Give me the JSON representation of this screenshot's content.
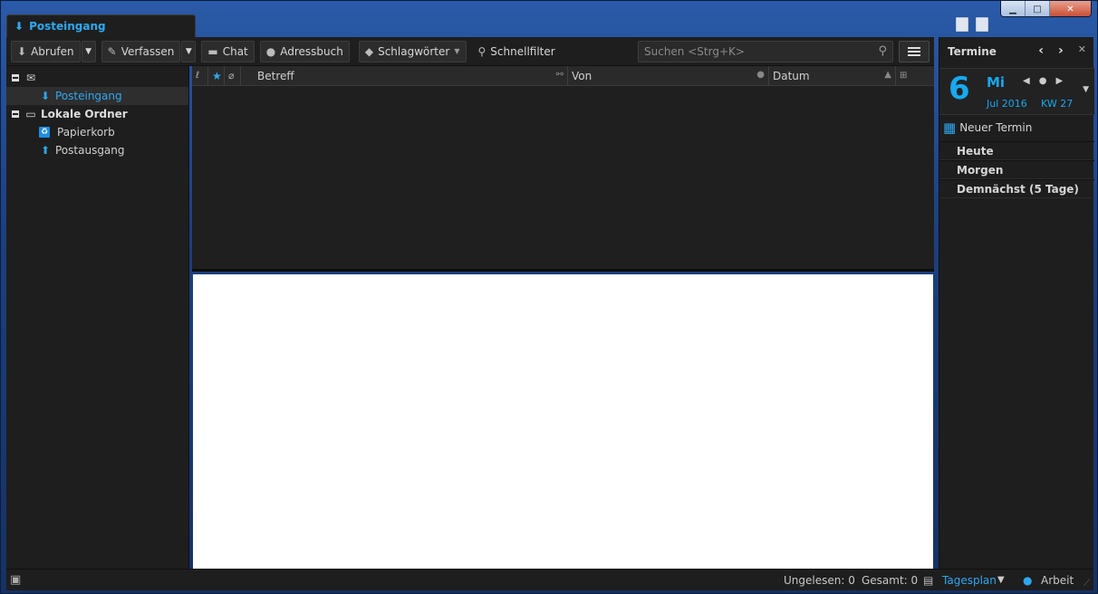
{
  "titlebar": {
    "tab_label": "Posteingang",
    "window_controls": {
      "minimize": "▁",
      "maximize": "□",
      "close": "✕"
    }
  },
  "toolbar": {
    "get_mail": "Abrufen",
    "compose": "Verfassen",
    "chat": "Chat",
    "address_book": "Adressbuch",
    "tags": "Schlagwörter",
    "quick_filter": "Schnellfilter",
    "search_placeholder": "Suchen <Strg+K>"
  },
  "folders": {
    "items": [
      {
        "label": "",
        "type": "account"
      },
      {
        "label": "Posteingang",
        "type": "inbox",
        "selected": true
      },
      {
        "label": "Lokale Ordner",
        "type": "local"
      },
      {
        "label": "Papierkorb",
        "type": "trash"
      },
      {
        "label": "Postausgang",
        "type": "outbox"
      }
    ]
  },
  "thread_columns": {
    "subject": "Betreff",
    "from": "Von",
    "date": "Datum"
  },
  "today_pane": {
    "title": "Termine",
    "day_number": "6",
    "weekday": "Mi",
    "month_year": "Jul 2016",
    "week": "KW 27",
    "new_event": "Neuer Termin",
    "sections": [
      "Heute",
      "Morgen",
      "Demnächst (5 Tage)"
    ]
  },
  "statusbar": {
    "unread": "Ungelesen: 0",
    "total": "Gesamt: 0",
    "today_mode": "Tagesplan",
    "identity": "Arbeit"
  },
  "colors": {
    "accent": "#2ea8f0",
    "background": "#1e1e1e",
    "window_frame": "#2a5aa8"
  }
}
